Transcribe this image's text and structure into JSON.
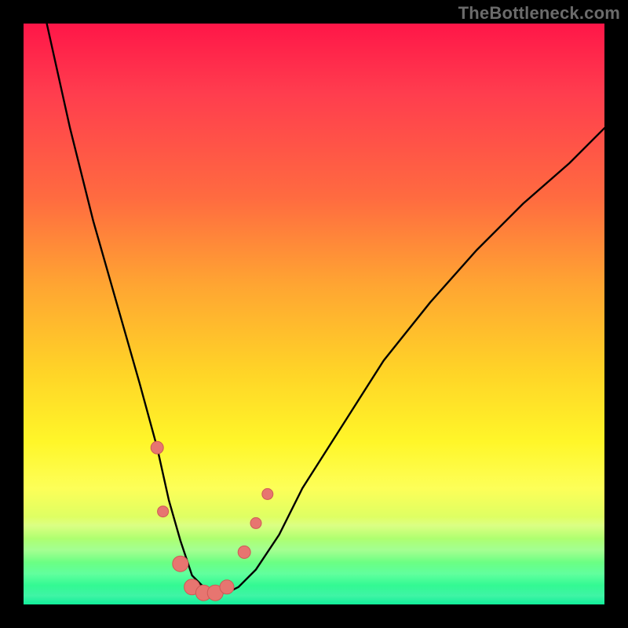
{
  "watermark": "TheBottleneck.com",
  "colors": {
    "frame": "#000000",
    "curve_stroke": "#000000",
    "marker_fill": "#e77570",
    "marker_outline": "#ce5a55",
    "gradient_top": "#ff1648",
    "gradient_bottom": "#11ee9a"
  },
  "chart_data": {
    "type": "line",
    "title": "",
    "xlabel": "",
    "ylabel": "",
    "xlim": [
      0,
      100
    ],
    "ylim": [
      0,
      100
    ],
    "grid": false,
    "series": [
      {
        "name": "bottleneck-curve",
        "x": [
          0,
          4,
          8,
          12,
          16,
          20,
          23,
          25,
          27,
          29,
          31,
          33,
          35,
          37,
          40,
          44,
          48,
          55,
          62,
          70,
          78,
          86,
          94,
          100
        ],
        "y": [
          120,
          100,
          82,
          66,
          52,
          38,
          27,
          18,
          11,
          5,
          3,
          2,
          2,
          3,
          6,
          12,
          20,
          31,
          42,
          52,
          61,
          69,
          76,
          82
        ]
      }
    ],
    "markers": [
      {
        "x": 23,
        "y": 27,
        "r": 8
      },
      {
        "x": 24,
        "y": 16,
        "r": 7
      },
      {
        "x": 27,
        "y": 7,
        "r": 10
      },
      {
        "x": 29,
        "y": 3,
        "r": 10
      },
      {
        "x": 31,
        "y": 2,
        "r": 10
      },
      {
        "x": 33,
        "y": 2,
        "r": 10
      },
      {
        "x": 35,
        "y": 3,
        "r": 9
      },
      {
        "x": 38,
        "y": 9,
        "r": 8
      },
      {
        "x": 40,
        "y": 14,
        "r": 7
      },
      {
        "x": 42,
        "y": 19,
        "r": 7
      }
    ]
  }
}
